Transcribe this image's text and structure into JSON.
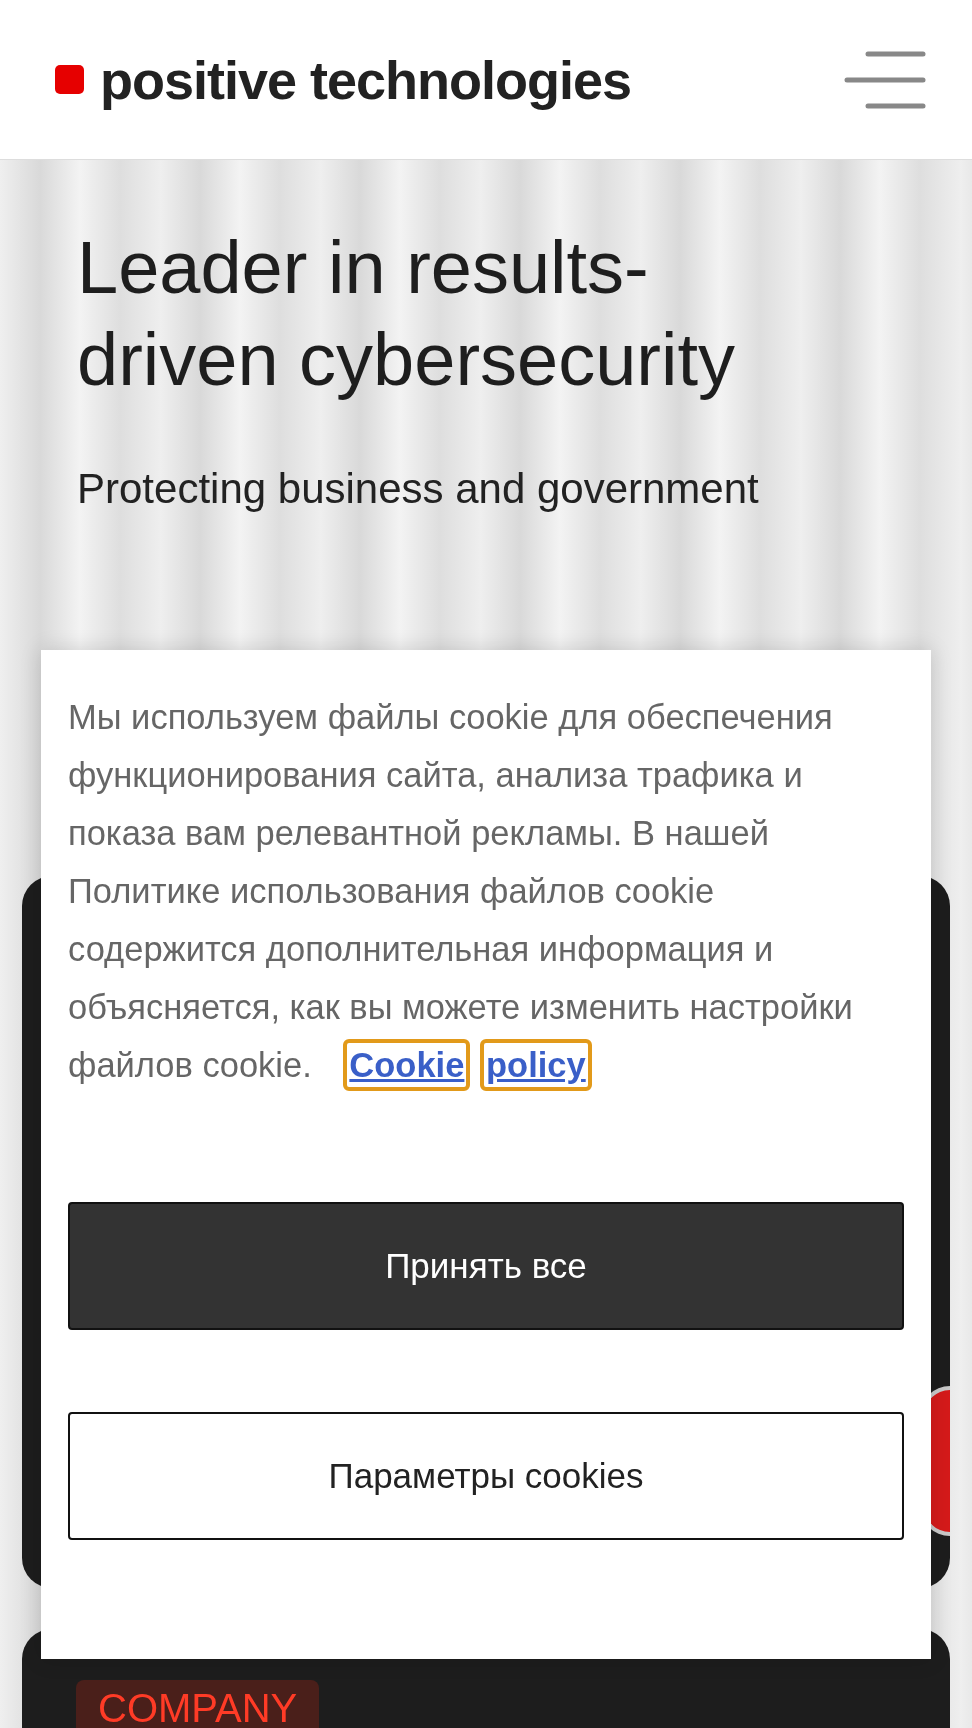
{
  "header": {
    "logo_text": "positive technologies"
  },
  "hero": {
    "heading": "Leader in results-driven cybersecurity",
    "paragraph": "Protecting business and government"
  },
  "company_card": {
    "tag": "COMPANY"
  },
  "cookie_banner": {
    "text": "Мы используем файлы cookie для обеспечения функционирования сайта, анализа трафика и показа вам релевантной рекламы. В нашей Политике использования файлов cookie содержится дополнительная информация и объясняется, как вы можете изменить настройки файлов cookie.",
    "link": "Cookie policy",
    "buttons": [
      {
        "label": "Принять все",
        "kind": "primary"
      },
      {
        "label": "Параметры cookies",
        "kind": "outline"
      }
    ]
  }
}
